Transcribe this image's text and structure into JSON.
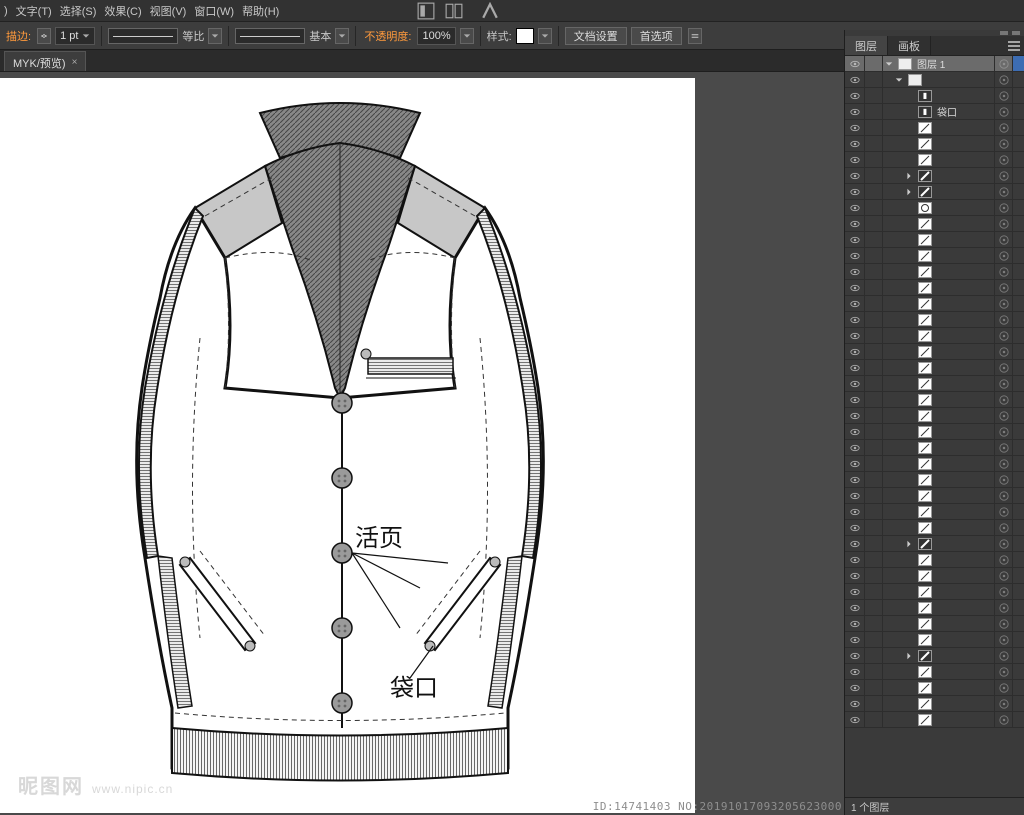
{
  "menu": {
    "items": [
      ")",
      "文字(T)",
      "选择(S)",
      "效果(C)",
      "视图(V)",
      "窗口(W)",
      "帮助(H)"
    ]
  },
  "options": {
    "stroke_label": "描边:",
    "stroke_value": "1 pt",
    "dash_label": "等比",
    "profile_label": "基本",
    "opacity_label": "不透明度:",
    "opacity_value": "100%",
    "style_label": "样式:",
    "btn_docsetup": "文档设置",
    "btn_prefs": "首选项"
  },
  "doc_tab": {
    "label": "MYK/预览)",
    "close": "×"
  },
  "watermark": {
    "main": "昵图网",
    "sub": "www.nipic.cn"
  },
  "idstamp": "ID:14741403 NO:20191017093205623000",
  "annotations": {
    "huoye": "活页",
    "daikou": "袋口"
  },
  "panel": {
    "tabs": [
      "图层",
      "画板"
    ],
    "layer_header_name": "图层 1",
    "sub_b": "袋口",
    "status": "1 个图层"
  },
  "layer_thumbs": [
    "file",
    "file",
    "tag",
    "tag",
    "line",
    "line",
    "line",
    "tri",
    "tri",
    "circle",
    "line",
    "line",
    "line",
    "line",
    "line",
    "line",
    "line",
    "line",
    "line",
    "line",
    "line",
    "line",
    "line",
    "line",
    "line",
    "line",
    "line",
    "line",
    "line",
    "line",
    "line",
    "tri",
    "line",
    "line",
    "line",
    "line",
    "line",
    "line",
    "line",
    "tri",
    "line",
    "line"
  ]
}
